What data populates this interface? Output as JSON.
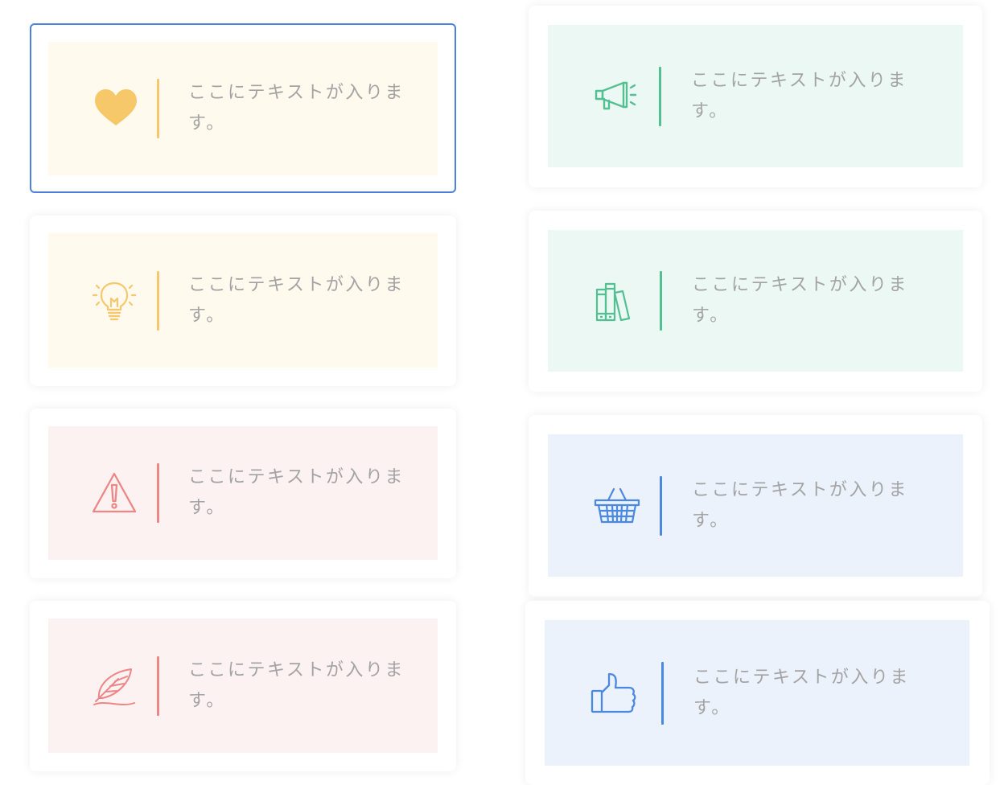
{
  "colors": {
    "yellow_bg": "#fff9ee",
    "yellow_fg": "#f6c86a",
    "green_bg": "#ebf8f3",
    "green_fg": "#52c093",
    "red_bg": "#fdf2f2",
    "red_fg": "#ee8686",
    "blue_bg": "#ebf2fc",
    "blue_fg": "#4b88e0",
    "selected_border": "#4d7fe0"
  },
  "cards": [
    {
      "id": "heart",
      "icon": "heart-icon",
      "color": "yellow",
      "selected": true,
      "text": "ここにテキストが入りま\nす。"
    },
    {
      "id": "megaphone",
      "icon": "megaphone-icon",
      "color": "green",
      "selected": false,
      "text": "ここにテキストが入りま\nす。"
    },
    {
      "id": "lightbulb",
      "icon": "lightbulb-icon",
      "color": "yellow",
      "selected": false,
      "text": "ここにテキストが入りま\nす。"
    },
    {
      "id": "books",
      "icon": "books-icon",
      "color": "green",
      "selected": false,
      "text": "ここにテキストが入りま\nす。"
    },
    {
      "id": "warning",
      "icon": "warning-icon",
      "color": "red",
      "selected": false,
      "text": "ここにテキストが入りま\nす。"
    },
    {
      "id": "basket",
      "icon": "basket-icon",
      "color": "blue",
      "selected": false,
      "text": "ここにテキストが入りま\nす。"
    },
    {
      "id": "feather",
      "icon": "feather-icon",
      "color": "red",
      "selected": false,
      "text": "ここにテキストが入りま\nす。"
    },
    {
      "id": "thumbsup",
      "icon": "thumbs-up-icon",
      "color": "blue",
      "selected": false,
      "text": "ここにテキストが入りま\nす。"
    }
  ]
}
